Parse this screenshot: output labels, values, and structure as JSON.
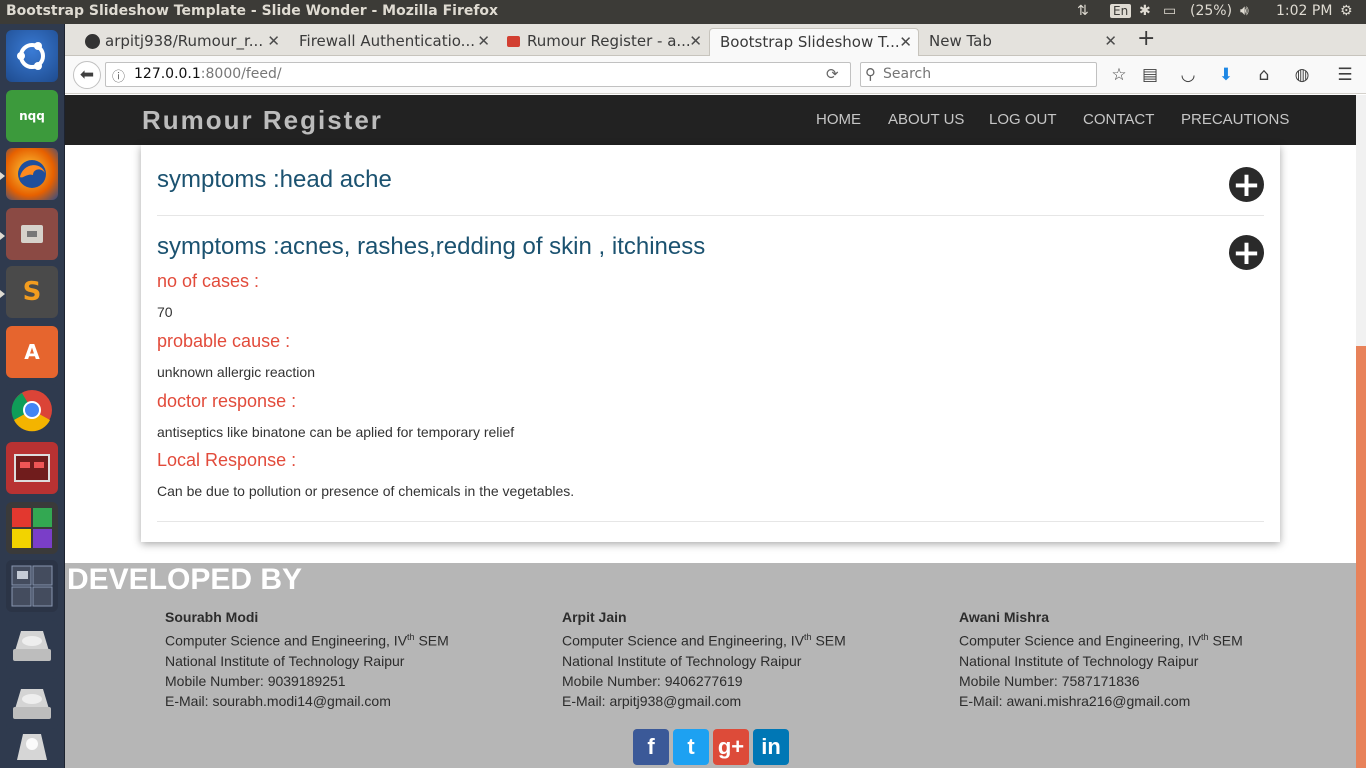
{
  "system_bar": {
    "window_title": "Bootstrap Slideshow Template - Slide Wonder - Mozilla Firefox",
    "keyboard": "En",
    "battery": "(25%)",
    "clock": "1:02 PM"
  },
  "launcher": {
    "apps": [
      {
        "name": "ubuntu-dash-icon",
        "label": ""
      },
      {
        "name": "nqq-notepad-icon",
        "label": "nqq"
      },
      {
        "name": "firefox-icon",
        "label": ""
      },
      {
        "name": "files-icon",
        "label": ""
      },
      {
        "name": "sublime-text-icon",
        "label": "S"
      },
      {
        "name": "software-center-icon",
        "label": "A"
      },
      {
        "name": "chrome-icon",
        "label": ""
      },
      {
        "name": "workspace-app-icon",
        "label": ""
      },
      {
        "name": "libreoffice-icon",
        "label": ""
      },
      {
        "name": "workspaces-icon",
        "label": ""
      },
      {
        "name": "drive-icon",
        "label": ""
      },
      {
        "name": "drive-icon",
        "label": ""
      },
      {
        "name": "trash-icon",
        "label": ""
      }
    ]
  },
  "tabs": [
    {
      "label": "arpitj938/Rumour_r...",
      "favicon_color": "#333333",
      "active": false
    },
    {
      "label": "Firewall Authenticatio...",
      "favicon_color": "",
      "active": false
    },
    {
      "label": "Rumour Register - a...",
      "favicon_color": "#d23f31",
      "active": false
    },
    {
      "label": "Bootstrap Slideshow T...",
      "favicon_color": "",
      "active": true
    },
    {
      "label": "New Tab",
      "favicon_color": "",
      "active": false
    }
  ],
  "url": {
    "host": "127.0.0.1",
    "path": ":8000/feed/"
  },
  "search": {
    "placeholder": "Search"
  },
  "site": {
    "brand": "Rumour Register",
    "menu": [
      "HOME",
      "ABOUT US",
      "LOG OUT",
      "CONTACT",
      "PRECAUTIONS"
    ]
  },
  "feed": {
    "collapsed_title": "symptoms :head ache",
    "expanded": {
      "title": "symptoms :acnes, rashes,redding of skin , itchiness",
      "fields": [
        {
          "label": "no of cases :",
          "value": "70"
        },
        {
          "label": "probable cause :",
          "value": "unknown allergic reaction"
        },
        {
          "label": "doctor response :",
          "value": "antiseptics like binatone can be aplied for temporary relief"
        },
        {
          "label": "Local Response :",
          "value": "Can be due to pollution or presence of chemicals in the vegetables."
        }
      ]
    }
  },
  "footer": {
    "title": "DEVELOPED BY",
    "developers": [
      {
        "name": "Sourabh Modi",
        "dept": "Computer Science and Engineering, IV",
        "sup": "th",
        "sem": " SEM",
        "college": "National Institute of Technology Raipur",
        "mobile": "Mobile Number: 9039189251",
        "email": "E-Mail: sourabh.modi14@gmail.com"
      },
      {
        "name": "Arpit Jain",
        "dept": "Computer Science and Engineering, IV",
        "sup": "th",
        "sem": " SEM",
        "college": "National Institute of Technology Raipur",
        "mobile": "Mobile Number: 9406277619",
        "email": "E-Mail: arpitj938@gmail.com"
      },
      {
        "name": "Awani Mishra",
        "dept": "Computer Science and Engineering, IV",
        "sup": "th",
        "sem": " SEM",
        "college": "National Institute of Technology Raipur",
        "mobile": "Mobile Number: 7587171836",
        "email": "E-Mail: awani.mishra216@gmail.com"
      }
    ],
    "social": [
      {
        "name": "facebook-icon",
        "glyph": "f",
        "color": "#3b5998"
      },
      {
        "name": "twitter-icon",
        "glyph": "t",
        "color": "#1da1f2"
      },
      {
        "name": "google-plus-icon",
        "glyph": "g+",
        "color": "#dd4b39"
      },
      {
        "name": "linkedin-icon",
        "glyph": "in",
        "color": "#0077b5"
      }
    ]
  },
  "colors": {
    "accent_red": "#e24b3b",
    "title_blue": "#1b5270",
    "navbar_dark": "#222222",
    "footer_grey": "#b6b6b6",
    "scroll_orange": "#e8825a"
  }
}
